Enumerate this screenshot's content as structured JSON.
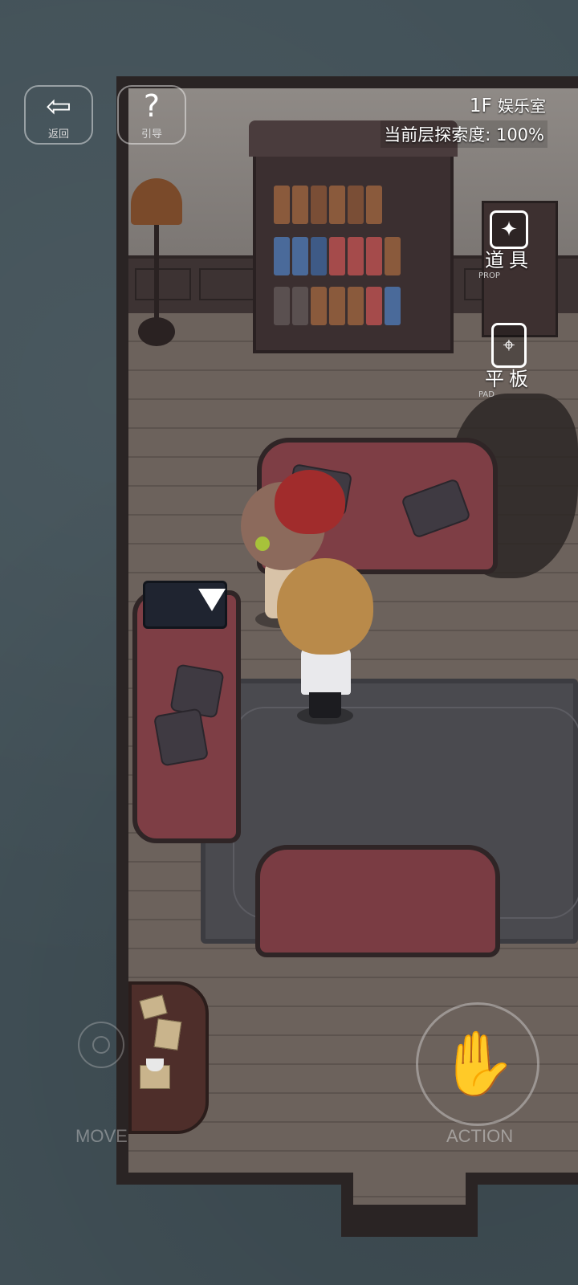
{
  "hud": {
    "back_label": "返回",
    "guide_label": "引导",
    "back_icon": "exit-arrow-icon",
    "guide_icon": "question-mark-icon",
    "guide_glyph": "?",
    "back_glyph": "⇦"
  },
  "location": {
    "floor": "1F",
    "room": "娱乐室",
    "explore_text": "当前层探索度: 100%"
  },
  "side_menu": {
    "props_label": "道具",
    "props_sub": "PROP",
    "props_icon": "toolbox-icon",
    "props_glyph": "✦",
    "pad_label": "平板",
    "pad_sub": "PAD",
    "pad_icon": "map-pin-icon",
    "pad_glyph": "⌖"
  },
  "controls": {
    "move_label": "MOVE",
    "action_label": "ACTION",
    "action_icon": "hand-icon",
    "action_glyph": "✋"
  },
  "colors": {
    "background": "#425158",
    "sofa": "#7e3e45",
    "hat": "#a12c2c",
    "indicator": "#ffffff"
  }
}
